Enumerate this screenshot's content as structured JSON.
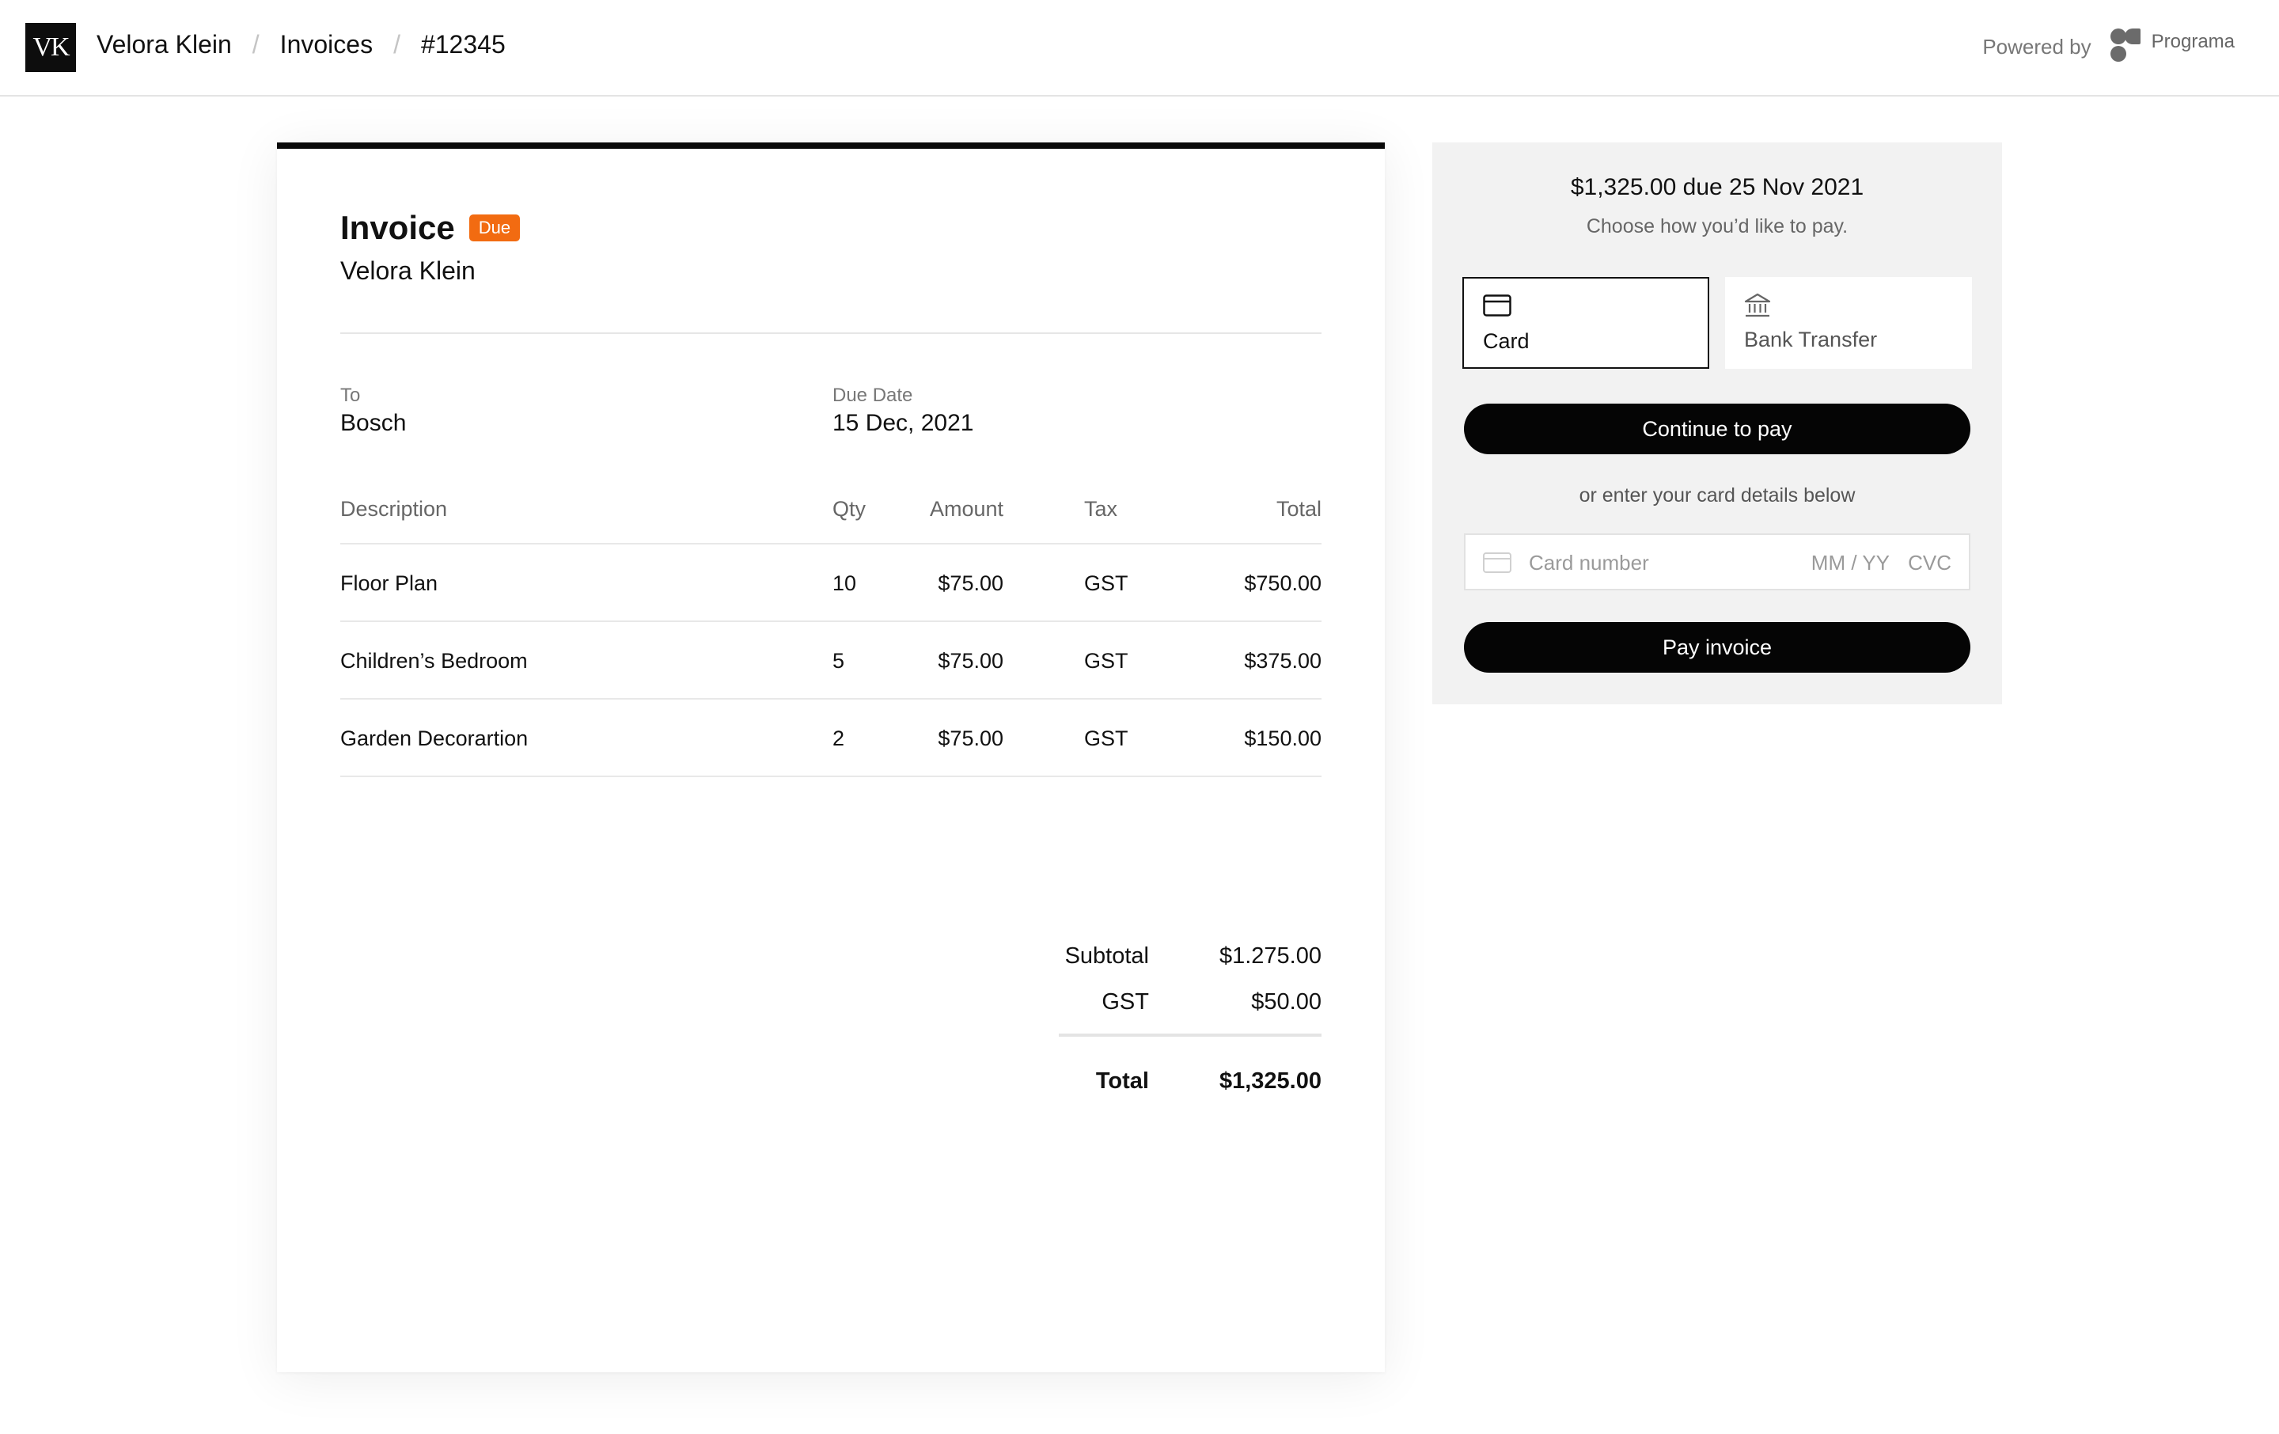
{
  "header": {
    "logo_text": "VK",
    "breadcrumb": {
      "account": "Velora Klein",
      "section": "Invoices",
      "current": "#12345",
      "separator": "/"
    },
    "powered_by_label": "Powered by",
    "powered_by_brand": "Programa"
  },
  "invoice": {
    "title": "Invoice",
    "status_badge": "Due",
    "status_color": "#f26b11",
    "from_name": "Velora Klein",
    "to_label": "To",
    "to_value": "Bosch",
    "due_date_label": "Due Date",
    "due_date_value": "15 Dec, 2021",
    "columns": {
      "description": "Description",
      "qty": "Qty",
      "amount": "Amount",
      "tax": "Tax",
      "total": "Total"
    },
    "line_items": [
      {
        "description": "Floor Plan",
        "qty": "10",
        "amount": "$75.00",
        "tax": "GST",
        "total": "$750.00"
      },
      {
        "description": "Children’s Bedroom",
        "qty": "5",
        "amount": "$75.00",
        "tax": "GST",
        "total": "$375.00"
      },
      {
        "description": "Garden Decorartion",
        "qty": "2",
        "amount": "$75.00",
        "tax": "GST",
        "total": "$150.00"
      }
    ],
    "summary": {
      "subtotal_label": "Subtotal",
      "subtotal_value": "$1.275.00",
      "tax_label": "GST",
      "tax_value": "$50.00",
      "total_label": "Total",
      "total_value": "$1,325.00"
    }
  },
  "payment": {
    "amount_due": "$1,325.00 due 25 Nov 2021",
    "instruction": "Choose how you’d like to pay.",
    "methods": [
      {
        "label": "Card",
        "icon": "credit-card-icon",
        "selected": true
      },
      {
        "label": "Bank Transfer",
        "icon": "bank-icon",
        "selected": false
      }
    ],
    "continue_label": "Continue to pay",
    "alt_text": "or enter your card details below",
    "card_number_placeholder": "Card number",
    "expiry_placeholder": "MM / YY",
    "cvc_placeholder": "CVC",
    "pay_label": "Pay invoice"
  }
}
